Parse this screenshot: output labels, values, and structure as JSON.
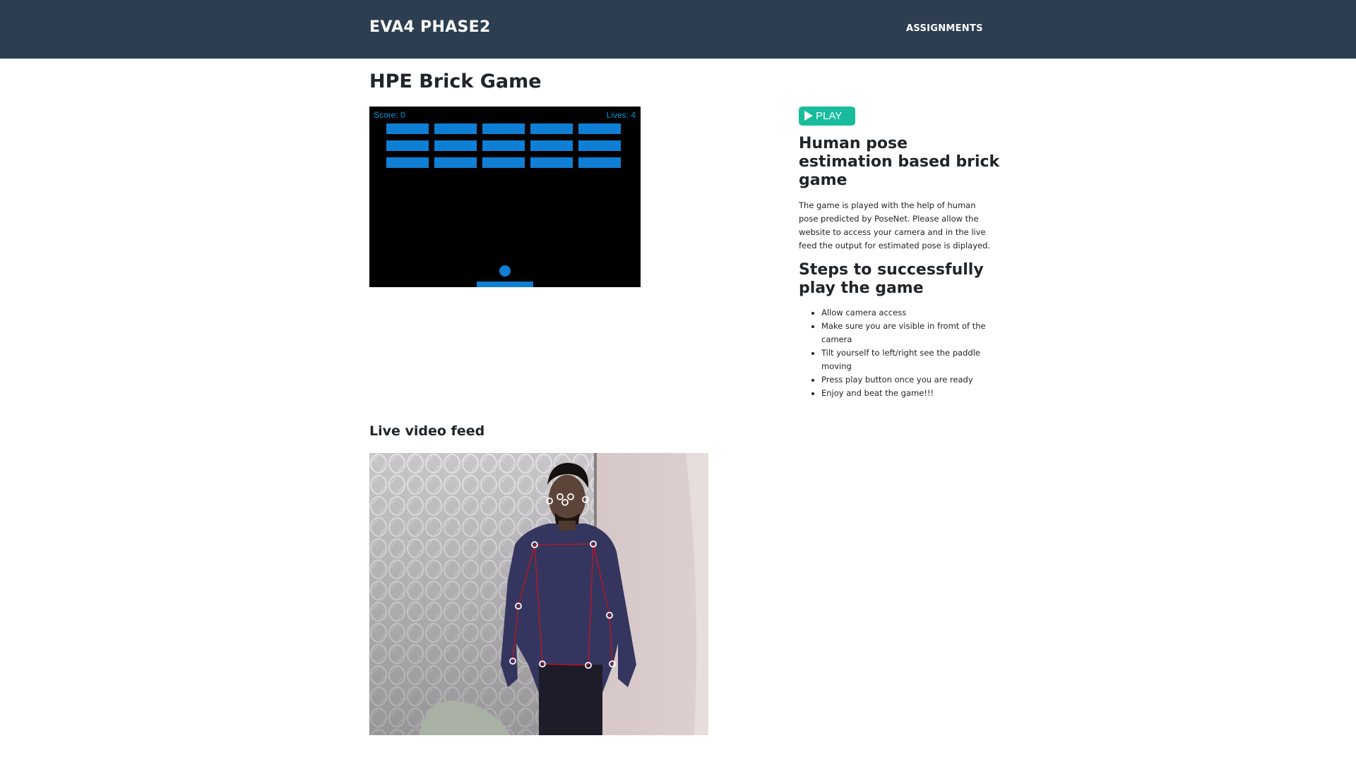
{
  "navbar": {
    "brand": "EVA4 PHASE2",
    "links": [
      "ASSIGNMENTS"
    ]
  },
  "page_title": "HPE Brick Game",
  "game": {
    "score_text": "Score: 0",
    "lives_text": "Lives: 4",
    "brick_rows": 3,
    "brick_columns": 5,
    "colors": {
      "background": "#000000",
      "bricks": "#0e7fd4",
      "hud_text": "#0095dd"
    }
  },
  "play_button": {
    "label": "PLAY",
    "icon": "play-icon",
    "color": "#18bc9c"
  },
  "intro": {
    "title": "Human pose estimation based brick game",
    "description": "The game is played with the help of human pose predicted by PoseNet. Please allow the website to access your camera and in the live feed the output for estimated pose is diplayed."
  },
  "steps": {
    "title": "Steps to successfully play the game",
    "items": [
      "Allow camera access",
      "Make sure you are visible in fromt of the camera",
      "Tilt yourself to left/right see the paddle moving",
      "Press play button once you are ready",
      "Enjoy and beat the game!!!"
    ]
  },
  "video": {
    "title": "Live video feed",
    "colors": {
      "skeleton_line": "#d0101a",
      "keypoint": "#ffffff"
    }
  },
  "colors": {
    "navbar": "#2c3e50",
    "accent": "#18bc9c"
  }
}
